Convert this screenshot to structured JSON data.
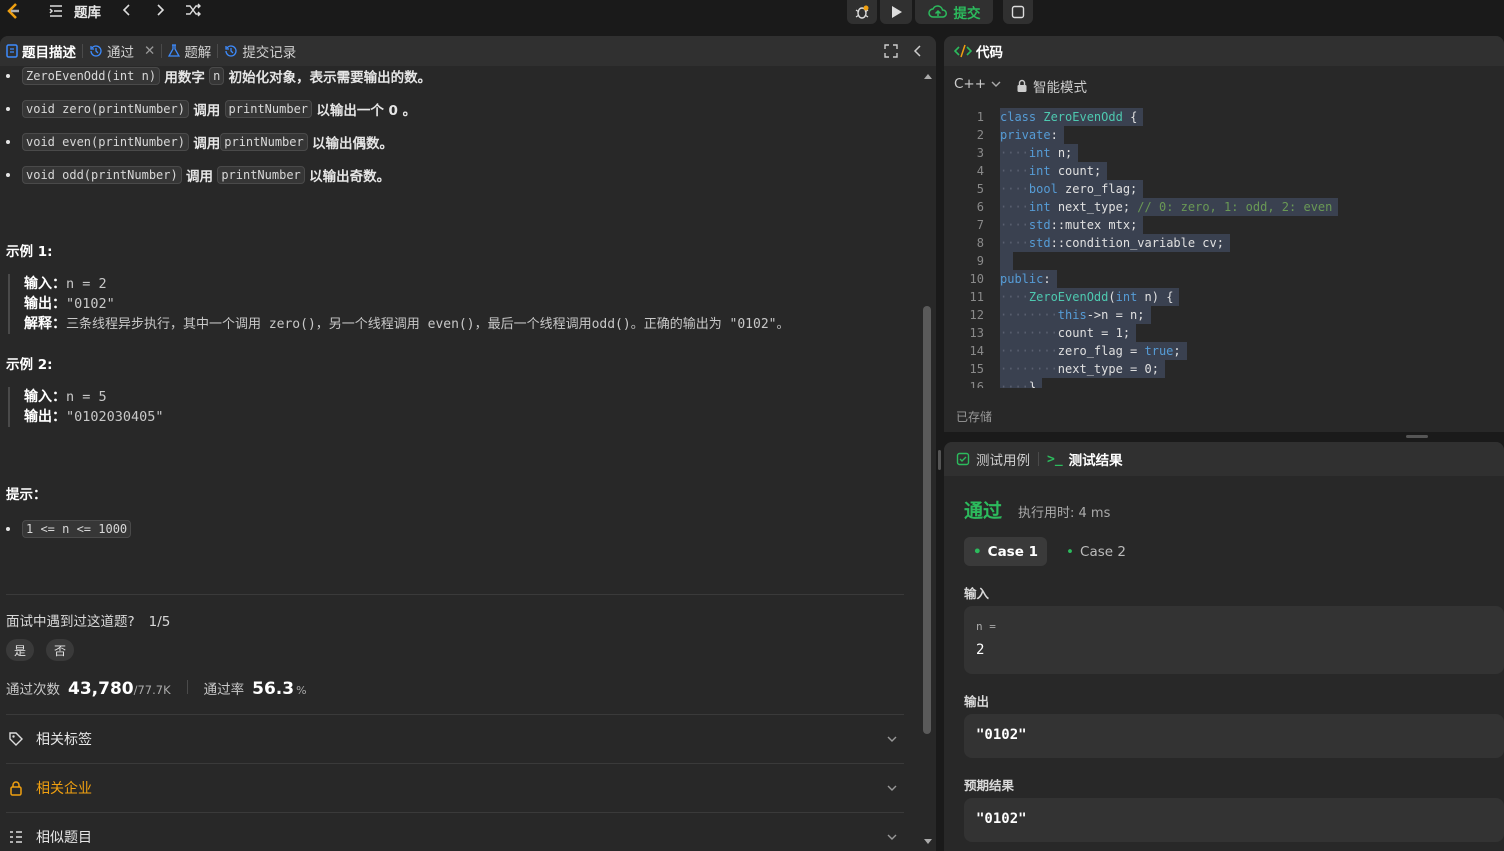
{
  "topbar": {
    "problem_list": "题库",
    "submit": "提交"
  },
  "left": {
    "tabs": [
      {
        "label": "题目描述"
      },
      {
        "label": "通过"
      },
      {
        "label": "题解"
      },
      {
        "label": "提交记录"
      }
    ],
    "bullets": [
      {
        "code": "ZeroEvenOdd(int n)",
        "t1": "用数字",
        "code2": "n",
        "t2": "初始化对象，表示需要输出的数。"
      },
      {
        "code": "void zero(printNumber)",
        "t1": "调用",
        "code2": "printNumber",
        "t2": "以输出一个 0 。"
      },
      {
        "code": "void even(printNumber)",
        "t1": "调用",
        "code2": "printNumber",
        "t2": "以输出偶数。"
      },
      {
        "code": "void odd(printNumber)",
        "t1": "调用",
        "code2": "printNumber",
        "t2": "以输出奇数。"
      }
    ],
    "example1": {
      "title": "示例 1:",
      "in_label": "输入：",
      "in_val": "n = 2",
      "out_label": "输出：",
      "out_val": "\"0102\"",
      "exp_label": "解释：",
      "exp_val": "三条线程异步执行，其中一个调用 zero()，另一个线程调用 even()，最后一个线程调用odd()。正确的输出为 \"0102\"。"
    },
    "example2": {
      "title": "示例 2:",
      "in_label": "输入：",
      "in_val": "n = 5",
      "out_label": "输出：",
      "out_val": "\"0102030405\""
    },
    "hint_title": "提示：",
    "hint": "1 <= n <= 1000",
    "interview_q": "面试中遇到过这道题?",
    "interview_ratio": "1/5",
    "yes": "是",
    "no": "否",
    "accepted_label": "通过次数",
    "accepted": "43,780",
    "submissions": "/77.7K",
    "rate_label": "通过率",
    "rate": "56.3",
    "rate_unit": "%",
    "related_tags": "相关标签",
    "related_companies": "相关企业",
    "similar": "相似题目"
  },
  "code_panel": {
    "title": "代码",
    "lang": "C++",
    "mode": "智能模式",
    "saved": "已存储",
    "lines": [
      "class ZeroEvenOdd {",
      "private:",
      "    int n;",
      "    int count;",
      "    bool zero_flag;",
      "    int next_type; // 0: zero, 1: odd, 2: even",
      "    std::mutex mtx;",
      "    std::condition_variable cv;",
      "",
      "public:",
      "    ZeroEvenOdd(int n) {",
      "        this->n = n;",
      "        count = 1;",
      "        zero_flag = true;",
      "        next_type = 0;",
      "    }"
    ]
  },
  "result_panel": {
    "tab_cases": "测试用例",
    "tab_result": "测试结果",
    "status": "通过",
    "runtime": "执行用时: 4 ms",
    "case1": "Case 1",
    "case2": "Case 2",
    "input_label": "输入",
    "input_name": "n =",
    "input_val": "2",
    "output_label": "输出",
    "output_val": "\"0102\"",
    "expected_label": "预期结果",
    "expected_val": "\"0102\""
  },
  "colors": {
    "accent_green": "#2cbb5d",
    "bg": "#1a1a1a",
    "panel": "#282828"
  }
}
